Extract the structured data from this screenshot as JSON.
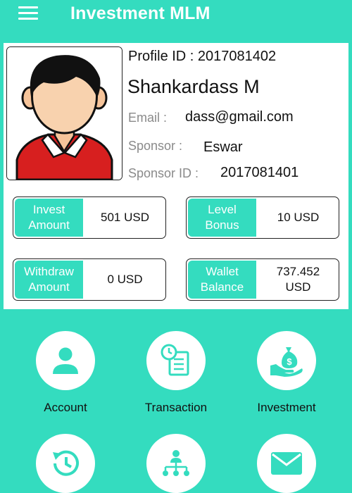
{
  "app": {
    "title": "Investment MLM"
  },
  "colors": {
    "primary": "#34dcbf",
    "card": "#ffffff",
    "text": "#111111",
    "label": "#8a8a8a"
  },
  "profile": {
    "id_text": "Profile ID : 2017081402",
    "name": "Shankardass M",
    "email_label": "Email :",
    "email": "dass@gmail.com",
    "sponsor_label": "Sponsor :",
    "sponsor": "Eswar",
    "sponsor_id_label": "Sponsor ID :",
    "sponsor_id": "2017081401",
    "avatar_icon": "user-avatar-icon"
  },
  "stats": [
    {
      "label": "Invest\nAmount",
      "value": "501 USD"
    },
    {
      "label": "Level\nBonus",
      "value": "10 USD"
    },
    {
      "label": "Withdraw\nAmount",
      "value": "0 USD"
    },
    {
      "label": "Wallet\nBalance",
      "value": "737.452\nUSD"
    }
  ],
  "menu": [
    {
      "label": "Account",
      "icon": "person-icon"
    },
    {
      "label": "Transaction",
      "icon": "transaction-document-icon"
    },
    {
      "label": "Investment",
      "icon": "money-bag-hand-icon"
    },
    {
      "label": "",
      "icon": "history-icon"
    },
    {
      "label": "",
      "icon": "network-tree-icon"
    },
    {
      "label": "",
      "icon": "mail-icon"
    }
  ]
}
